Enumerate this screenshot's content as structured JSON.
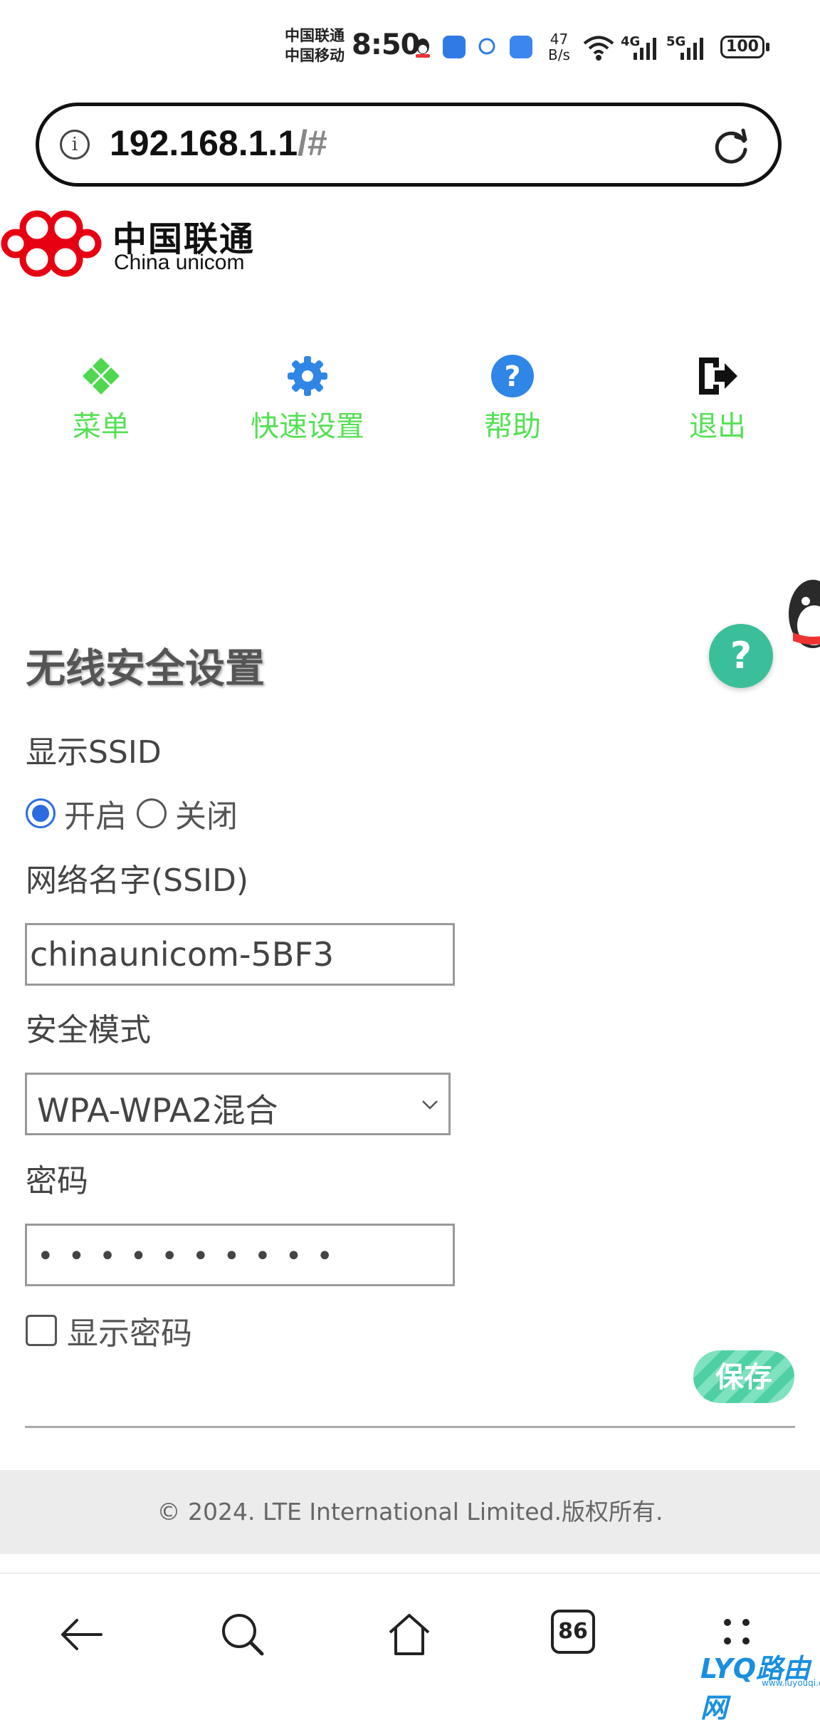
{
  "status_bar": {
    "carrier_1": "中国联通",
    "carrier_2": "中国移动",
    "time": "8:50",
    "net_speed_value": "47",
    "net_speed_unit": "B/s",
    "signal_1_label": "4G",
    "signal_2_label": "5G",
    "battery": "100"
  },
  "browser": {
    "url_host": "192.168.1.1",
    "url_path": "/#",
    "tabs_count": "86"
  },
  "brand": {
    "name_cn": "中国联通",
    "name_en": "China unicom",
    "red": "#e60012"
  },
  "top_nav": {
    "menu": "菜单",
    "quick_setup": "快速设置",
    "help": "帮助",
    "logout": "退出"
  },
  "help_float": "?",
  "form": {
    "title": "无线安全设置",
    "show_ssid_label": "显示SSID",
    "radio_on": "开启",
    "radio_off": "关闭",
    "radio_selected": "开启",
    "ssid_label": "网络名字(SSID)",
    "ssid_value": "chinaunicom-5BF3",
    "security_label": "安全模式",
    "security_value": "WPA-WPA2混合",
    "password_label": "密码",
    "password_mask": "••••••••••",
    "show_password_label": "显示密码",
    "show_password_checked": false,
    "save_label": "保存"
  },
  "footer": {
    "copyright": "© 2024. LTE International Limited.版权所有."
  },
  "watermark": {
    "text": "LYQ路由网",
    "url": "www.luyouqi.com"
  },
  "colors": {
    "nav_label": "#55e055",
    "accent_green": "#3bbf9a",
    "radio_blue": "#2b6de0"
  }
}
